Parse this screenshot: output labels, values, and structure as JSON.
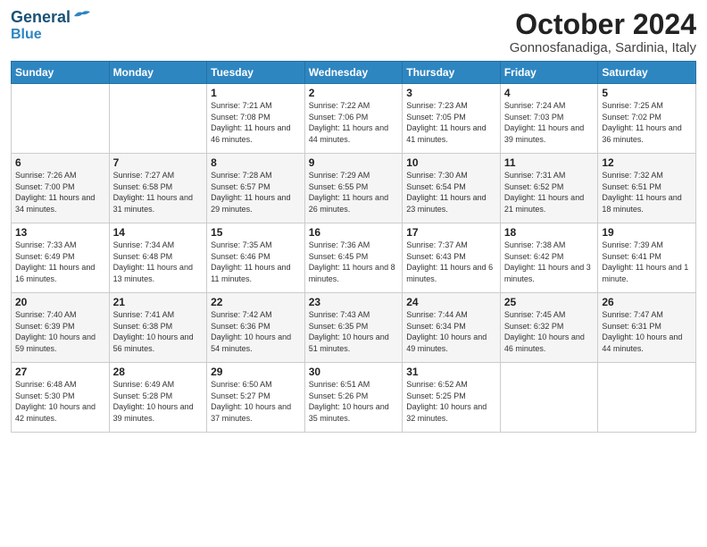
{
  "header": {
    "logo_line1": "General",
    "logo_line2": "Blue",
    "month": "October 2024",
    "location": "Gonnosfanadiga, Sardinia, Italy"
  },
  "days_of_week": [
    "Sunday",
    "Monday",
    "Tuesday",
    "Wednesday",
    "Thursday",
    "Friday",
    "Saturday"
  ],
  "weeks": [
    [
      {
        "day": "",
        "info": ""
      },
      {
        "day": "",
        "info": ""
      },
      {
        "day": "1",
        "info": "Sunrise: 7:21 AM\nSunset: 7:08 PM\nDaylight: 11 hours and 46 minutes."
      },
      {
        "day": "2",
        "info": "Sunrise: 7:22 AM\nSunset: 7:06 PM\nDaylight: 11 hours and 44 minutes."
      },
      {
        "day": "3",
        "info": "Sunrise: 7:23 AM\nSunset: 7:05 PM\nDaylight: 11 hours and 41 minutes."
      },
      {
        "day": "4",
        "info": "Sunrise: 7:24 AM\nSunset: 7:03 PM\nDaylight: 11 hours and 39 minutes."
      },
      {
        "day": "5",
        "info": "Sunrise: 7:25 AM\nSunset: 7:02 PM\nDaylight: 11 hours and 36 minutes."
      }
    ],
    [
      {
        "day": "6",
        "info": "Sunrise: 7:26 AM\nSunset: 7:00 PM\nDaylight: 11 hours and 34 minutes."
      },
      {
        "day": "7",
        "info": "Sunrise: 7:27 AM\nSunset: 6:58 PM\nDaylight: 11 hours and 31 minutes."
      },
      {
        "day": "8",
        "info": "Sunrise: 7:28 AM\nSunset: 6:57 PM\nDaylight: 11 hours and 29 minutes."
      },
      {
        "day": "9",
        "info": "Sunrise: 7:29 AM\nSunset: 6:55 PM\nDaylight: 11 hours and 26 minutes."
      },
      {
        "day": "10",
        "info": "Sunrise: 7:30 AM\nSunset: 6:54 PM\nDaylight: 11 hours and 23 minutes."
      },
      {
        "day": "11",
        "info": "Sunrise: 7:31 AM\nSunset: 6:52 PM\nDaylight: 11 hours and 21 minutes."
      },
      {
        "day": "12",
        "info": "Sunrise: 7:32 AM\nSunset: 6:51 PM\nDaylight: 11 hours and 18 minutes."
      }
    ],
    [
      {
        "day": "13",
        "info": "Sunrise: 7:33 AM\nSunset: 6:49 PM\nDaylight: 11 hours and 16 minutes."
      },
      {
        "day": "14",
        "info": "Sunrise: 7:34 AM\nSunset: 6:48 PM\nDaylight: 11 hours and 13 minutes."
      },
      {
        "day": "15",
        "info": "Sunrise: 7:35 AM\nSunset: 6:46 PM\nDaylight: 11 hours and 11 minutes."
      },
      {
        "day": "16",
        "info": "Sunrise: 7:36 AM\nSunset: 6:45 PM\nDaylight: 11 hours and 8 minutes."
      },
      {
        "day": "17",
        "info": "Sunrise: 7:37 AM\nSunset: 6:43 PM\nDaylight: 11 hours and 6 minutes."
      },
      {
        "day": "18",
        "info": "Sunrise: 7:38 AM\nSunset: 6:42 PM\nDaylight: 11 hours and 3 minutes."
      },
      {
        "day": "19",
        "info": "Sunrise: 7:39 AM\nSunset: 6:41 PM\nDaylight: 11 hours and 1 minute."
      }
    ],
    [
      {
        "day": "20",
        "info": "Sunrise: 7:40 AM\nSunset: 6:39 PM\nDaylight: 10 hours and 59 minutes."
      },
      {
        "day": "21",
        "info": "Sunrise: 7:41 AM\nSunset: 6:38 PM\nDaylight: 10 hours and 56 minutes."
      },
      {
        "day": "22",
        "info": "Sunrise: 7:42 AM\nSunset: 6:36 PM\nDaylight: 10 hours and 54 minutes."
      },
      {
        "day": "23",
        "info": "Sunrise: 7:43 AM\nSunset: 6:35 PM\nDaylight: 10 hours and 51 minutes."
      },
      {
        "day": "24",
        "info": "Sunrise: 7:44 AM\nSunset: 6:34 PM\nDaylight: 10 hours and 49 minutes."
      },
      {
        "day": "25",
        "info": "Sunrise: 7:45 AM\nSunset: 6:32 PM\nDaylight: 10 hours and 46 minutes."
      },
      {
        "day": "26",
        "info": "Sunrise: 7:47 AM\nSunset: 6:31 PM\nDaylight: 10 hours and 44 minutes."
      }
    ],
    [
      {
        "day": "27",
        "info": "Sunrise: 6:48 AM\nSunset: 5:30 PM\nDaylight: 10 hours and 42 minutes."
      },
      {
        "day": "28",
        "info": "Sunrise: 6:49 AM\nSunset: 5:28 PM\nDaylight: 10 hours and 39 minutes."
      },
      {
        "day": "29",
        "info": "Sunrise: 6:50 AM\nSunset: 5:27 PM\nDaylight: 10 hours and 37 minutes."
      },
      {
        "day": "30",
        "info": "Sunrise: 6:51 AM\nSunset: 5:26 PM\nDaylight: 10 hours and 35 minutes."
      },
      {
        "day": "31",
        "info": "Sunrise: 6:52 AM\nSunset: 5:25 PM\nDaylight: 10 hours and 32 minutes."
      },
      {
        "day": "",
        "info": ""
      },
      {
        "day": "",
        "info": ""
      }
    ]
  ]
}
